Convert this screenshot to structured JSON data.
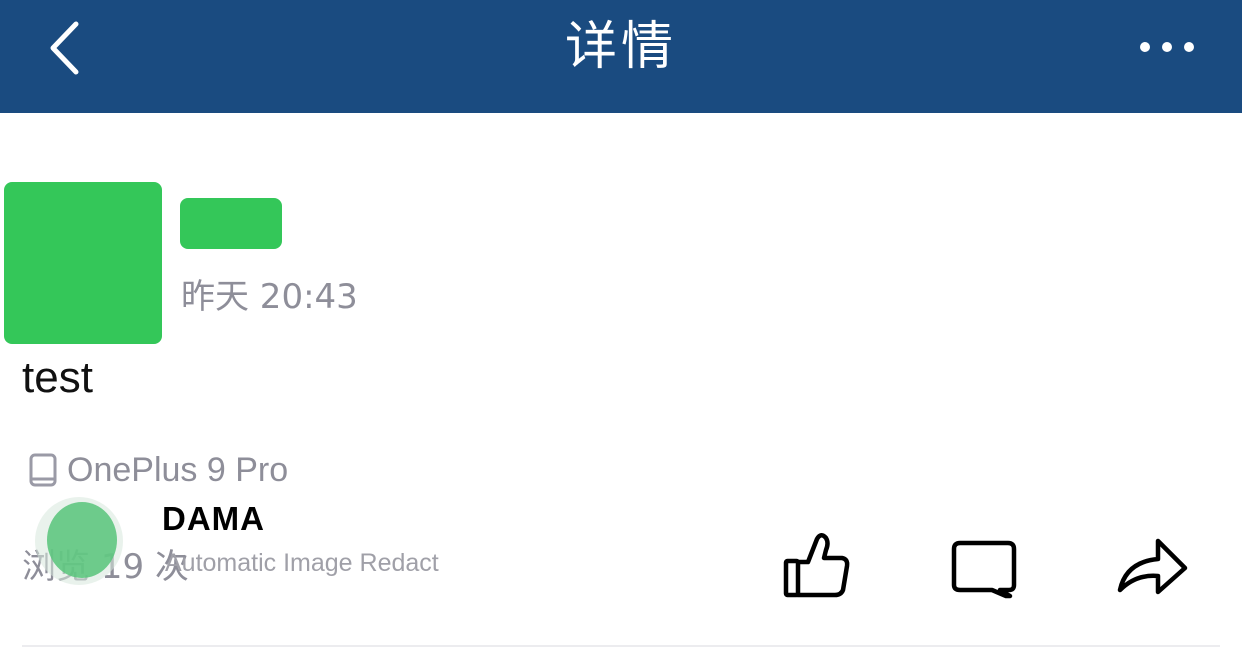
{
  "header": {
    "title": "详情",
    "back_icon": "chevron-left-icon",
    "more_icon": "more-horizontal-icon",
    "background_color": "#1a4b80"
  },
  "post": {
    "avatar_color": "#34c759",
    "timestamp": "昨天 20:43",
    "content": "test",
    "device_icon": "phone-icon",
    "device": "OnePlus 9 Pro",
    "views": "浏览 19 次"
  },
  "actions": {
    "like_icon": "thumbs-up-icon",
    "comment_icon": "comment-icon",
    "share_icon": "share-icon"
  },
  "watermark": {
    "title": "DAMA",
    "subtitle": "Automatic Image Redact"
  }
}
